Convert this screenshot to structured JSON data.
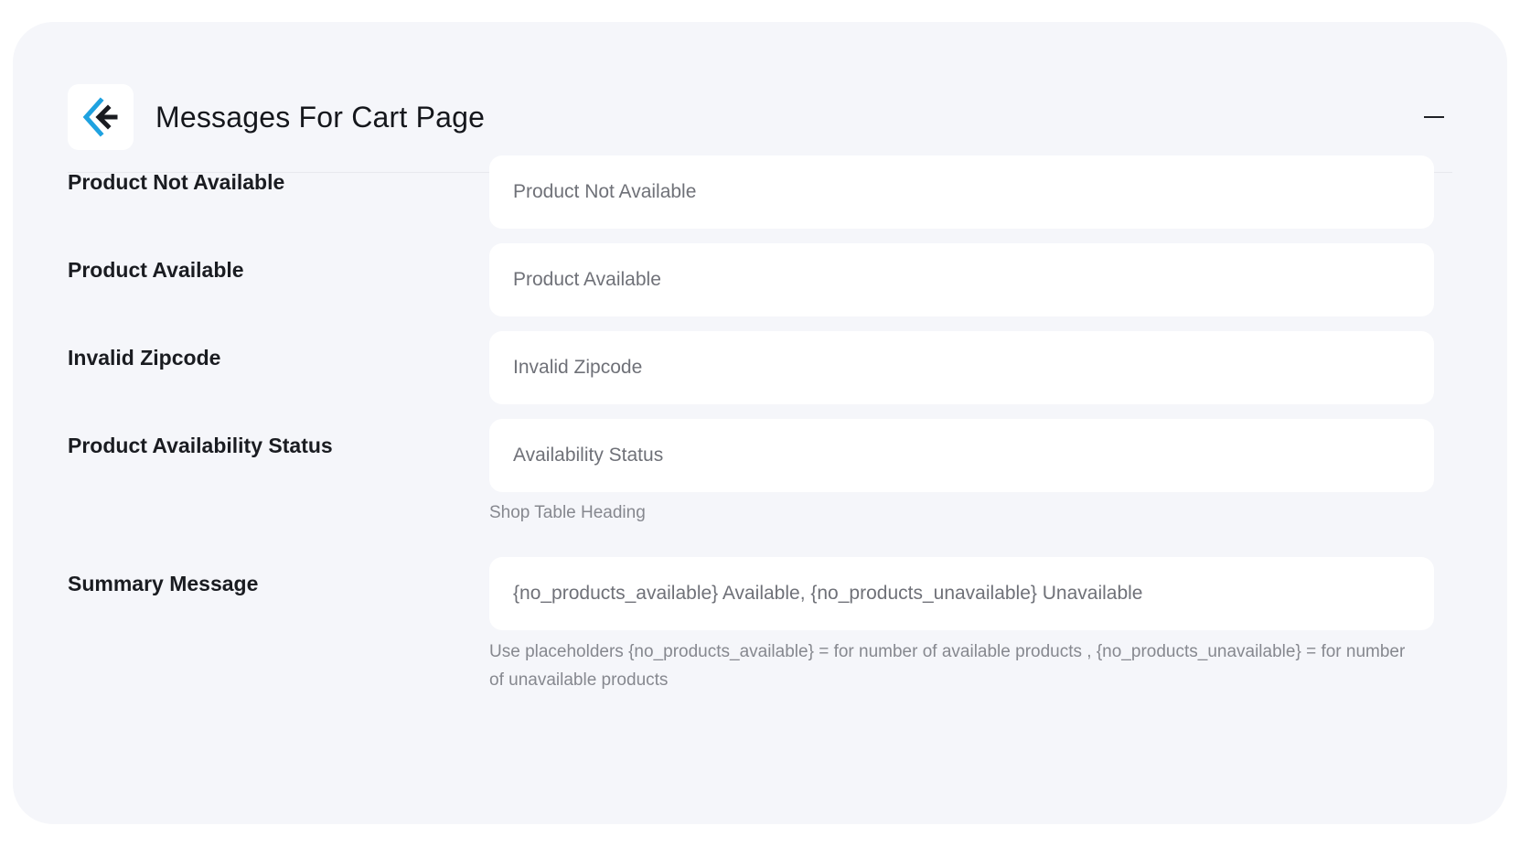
{
  "header": {
    "title": "Messages For Cart Page",
    "logo_icon": "brand-chevron-logo-icon",
    "collapse_icon": "minus-icon"
  },
  "colors": {
    "panel_bg": "#f5f6fa",
    "logo_blue": "#1fa2e0",
    "logo_dark": "#1a1c21"
  },
  "fields": {
    "product_not_available": {
      "label": "Product Not Available",
      "value": "Product Not Available"
    },
    "product_available": {
      "label": "Product Available",
      "value": "Product Available"
    },
    "invalid_zipcode": {
      "label": "Invalid Zipcode",
      "value": "Invalid Zipcode"
    },
    "availability_status": {
      "label": "Product Availability Status",
      "value": "Availability Status",
      "hint": "Shop Table Heading"
    },
    "summary_message": {
      "label": "Summary Message",
      "value": "{no_products_available} Available, {no_products_unavailable} Unavailable",
      "hint": "Use placeholders {no_products_available} = for number of available products , {no_products_unavailable} = for number of unavailable products"
    }
  }
}
